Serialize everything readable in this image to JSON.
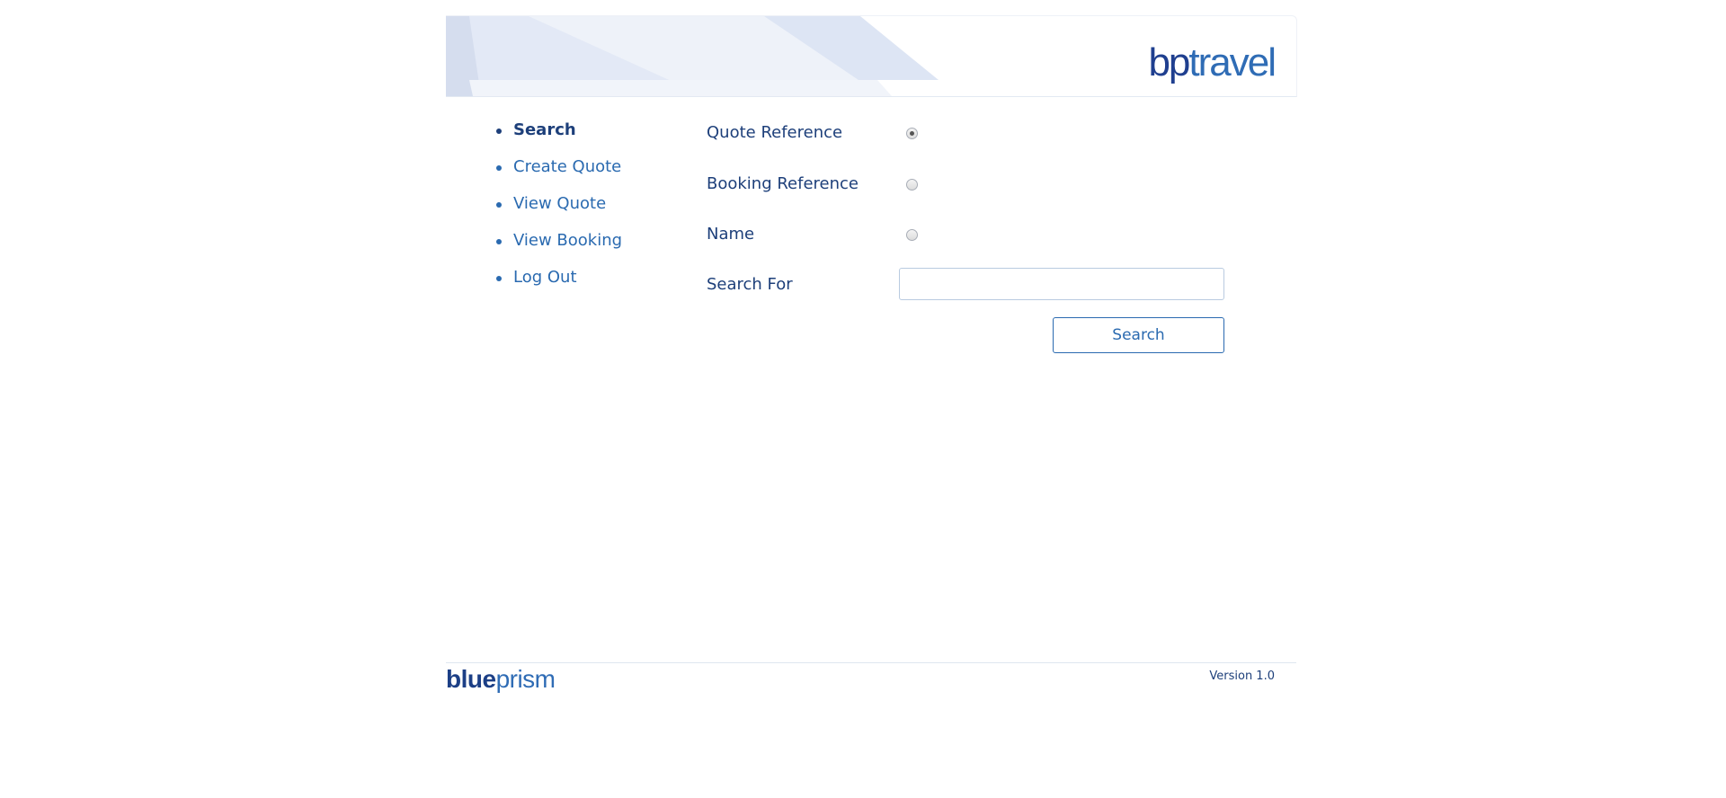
{
  "header": {
    "logo_bp": "bp",
    "logo_travel": "travel"
  },
  "nav": {
    "items": [
      {
        "label": "Search",
        "active": true
      },
      {
        "label": "Create Quote",
        "active": false
      },
      {
        "label": "View Quote",
        "active": false
      },
      {
        "label": "View Booking",
        "active": false
      },
      {
        "label": "Log Out",
        "active": false
      }
    ]
  },
  "form": {
    "options": [
      {
        "label": "Quote Reference",
        "checked": true
      },
      {
        "label": "Booking Reference",
        "checked": false
      },
      {
        "label": "Name",
        "checked": false
      }
    ],
    "search_for_label": "Search For",
    "search_for_value": "",
    "search_for_placeholder": "",
    "submit_label": "Search"
  },
  "footer": {
    "logo_blue": "blue",
    "logo_prism": "prism",
    "version": "Version 1.0"
  },
  "colors": {
    "primary": "#1d3f7a",
    "link": "#2a6ab0",
    "header_band": "#e6ecf7"
  }
}
